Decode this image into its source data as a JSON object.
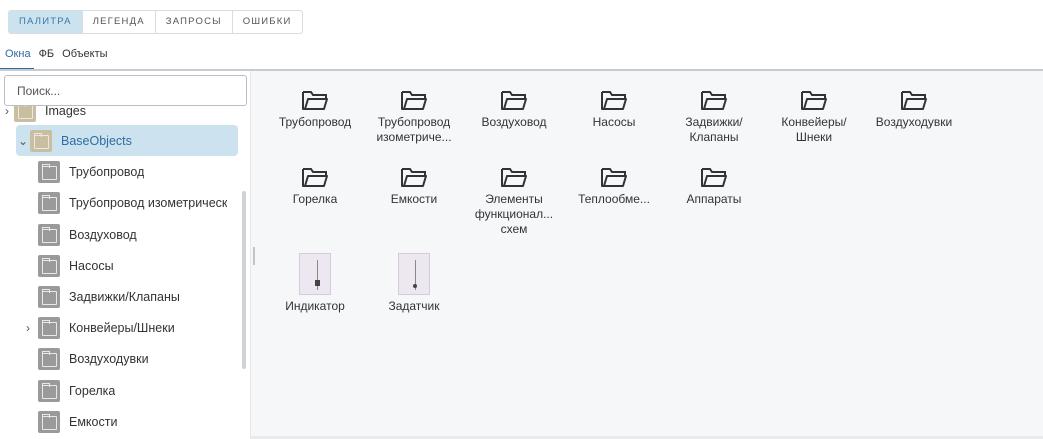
{
  "top_tabs": [
    "ПАЛИТРА",
    "ЛЕГЕНДА",
    "ЗАПРОСЫ",
    "ОШИБКИ"
  ],
  "sub_tabs": [
    "Окна",
    "ФБ",
    "Объекты"
  ],
  "search": {
    "placeholder": "Поиск..."
  },
  "tree": {
    "images_label": "Images",
    "base_label": "BaseObjects",
    "children": [
      "Трубопровод",
      "Трубопровод изометрическ",
      "Воздуховод",
      "Насосы",
      "Задвижки/Клапаны",
      "Конвейеры/Шнеки",
      "Воздуходувки",
      "Горелка",
      "Емкости"
    ]
  },
  "grid": {
    "folders": [
      [
        "Трубопровод"
      ],
      [
        "Трубопровод",
        "изометриче..."
      ],
      [
        "Воздуховод"
      ],
      [
        "Насосы"
      ],
      [
        "Задвижки/",
        "Клапаны"
      ],
      [
        "Конвейеры/",
        "Шнеки"
      ],
      [
        "Воздуходувки"
      ],
      [
        "Горелка"
      ],
      [
        "Емкости"
      ],
      [
        "Элементы",
        "функционал...",
        "схем"
      ],
      [
        "Теплообме..."
      ],
      [
        "Аппараты"
      ]
    ],
    "objects": [
      "Индикатор",
      "Задатчик"
    ]
  }
}
